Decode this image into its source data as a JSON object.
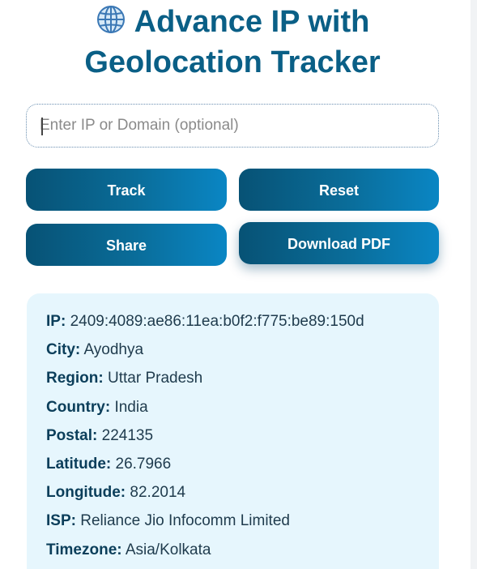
{
  "header": {
    "icon": "globe-icon",
    "title_line1": "Advance IP with",
    "title_line2": "Geolocation Tracker"
  },
  "search": {
    "value": "",
    "placeholder": "Enter IP or Domain (optional)"
  },
  "buttons": {
    "track": "Track",
    "reset": "Reset",
    "share": "Share",
    "download_pdf": "Download PDF"
  },
  "result": {
    "rows": [
      {
        "label": "IP:",
        "value": "2409:4089:ae86:11ea:b0f2:f775:be89:150d"
      },
      {
        "label": "City:",
        "value": "Ayodhya"
      },
      {
        "label": "Region:",
        "value": "Uttar Pradesh"
      },
      {
        "label": "Country:",
        "value": "India"
      },
      {
        "label": "Postal:",
        "value": "224135"
      },
      {
        "label": "Latitude:",
        "value": "26.7966"
      },
      {
        "label": "Longitude:",
        "value": "82.2014"
      },
      {
        "label": "ISP:",
        "value": "Reliance Jio Infocomm Limited"
      },
      {
        "label": "Timezone:",
        "value": "Asia/Kolkata"
      }
    ]
  },
  "colors": {
    "title": "#0a5f86",
    "button_start": "#075275",
    "button_end": "#0a86c4",
    "card_background": "#e6f6fd",
    "label_text": "#0b3e5a"
  }
}
